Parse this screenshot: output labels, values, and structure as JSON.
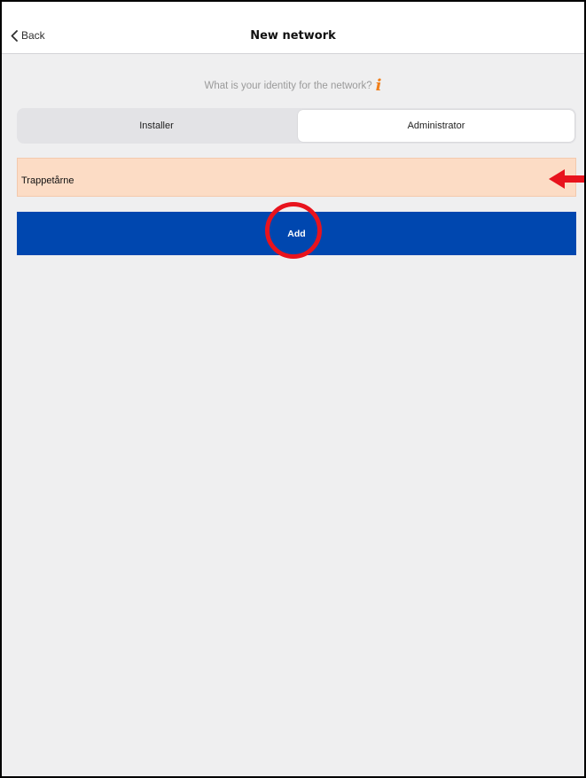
{
  "navbar": {
    "back_label": "Back",
    "title": "New network"
  },
  "prompt": {
    "text": "What is your identity for the network?",
    "info_icon": "info-icon"
  },
  "segment": {
    "options": [
      "Installer",
      "Administrator"
    ],
    "selected": "Administrator"
  },
  "network_name": {
    "value": "Trappetårne"
  },
  "add_button": {
    "label": "Add"
  },
  "colors": {
    "accent_blue": "#0047af",
    "field_highlight": "#fcdcc5",
    "info_orange": "#f07f1b",
    "annotation_red": "#e8131d"
  }
}
